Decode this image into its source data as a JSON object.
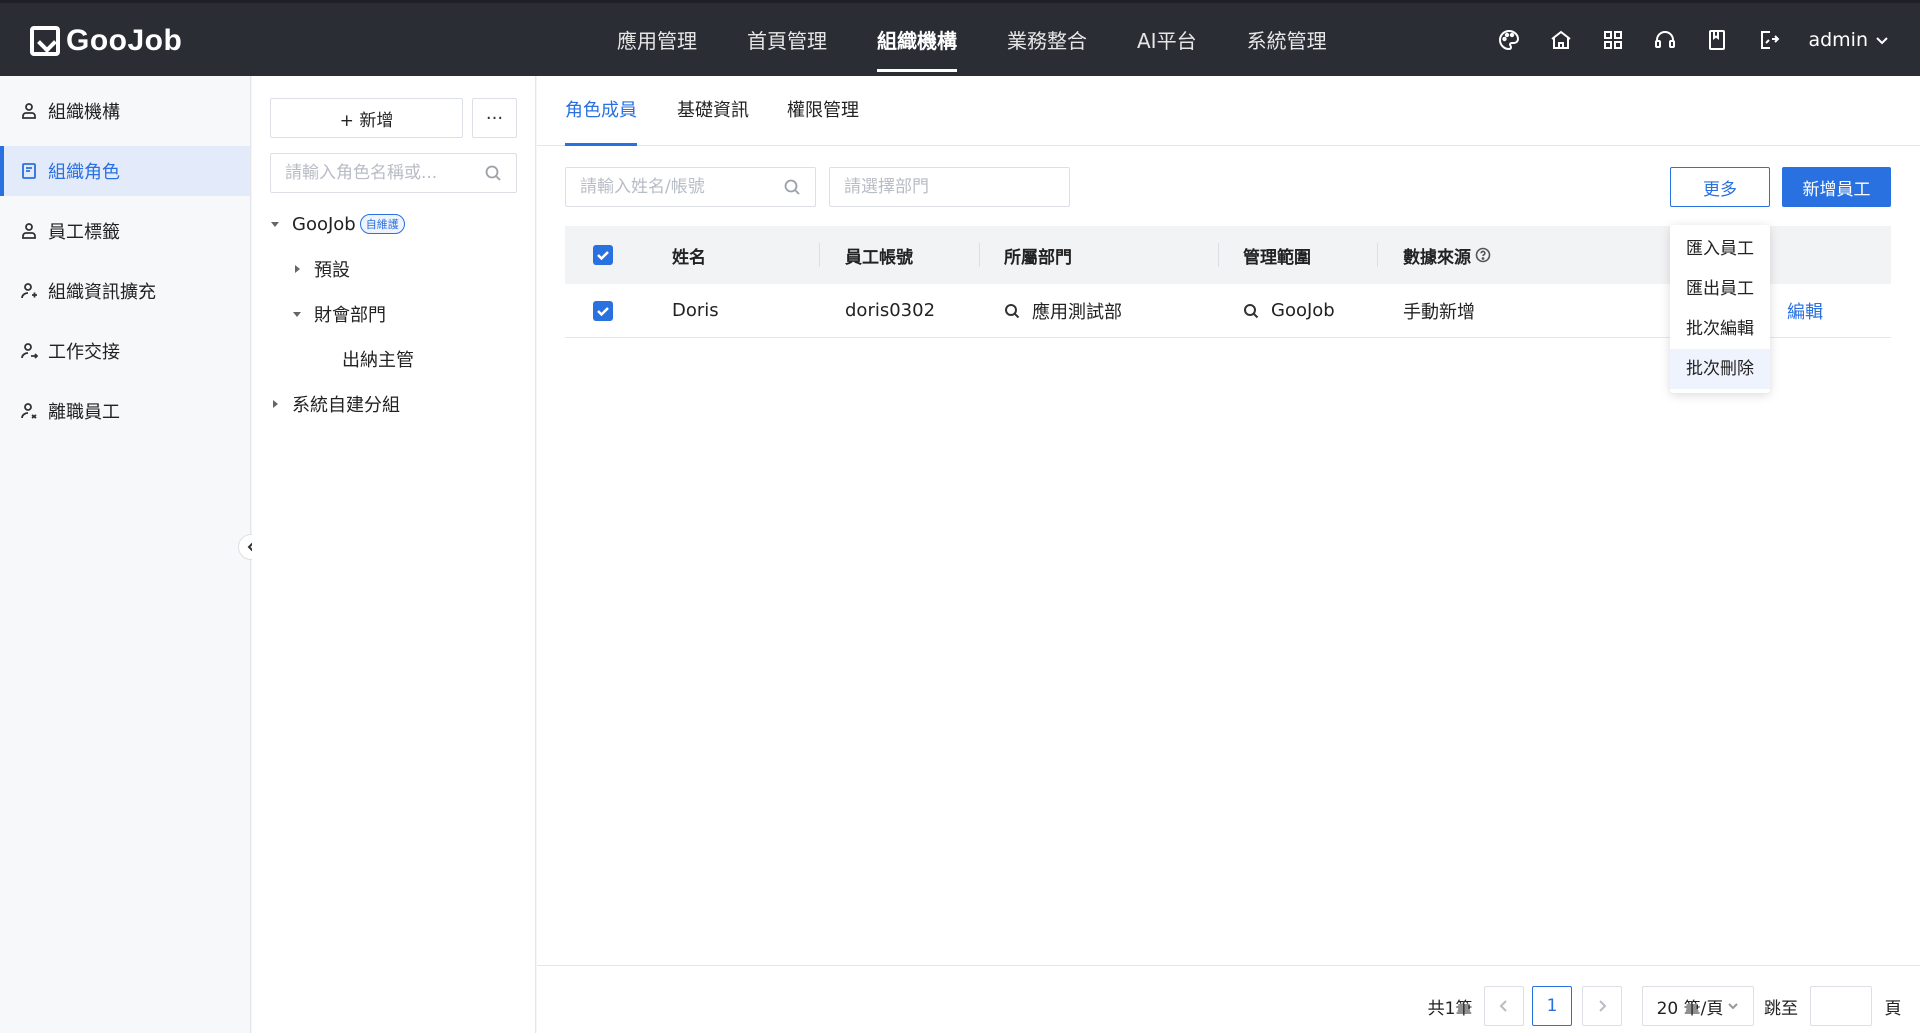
{
  "brand": {
    "name": "GooJob"
  },
  "topnav": {
    "items": [
      {
        "label": "應用管理"
      },
      {
        "label": "首頁管理"
      },
      {
        "label": "組織機構"
      },
      {
        "label": "業務整合"
      },
      {
        "label": "AI平台"
      },
      {
        "label": "系統管理"
      }
    ],
    "active": "組織機構",
    "icons": [
      "palette-icon",
      "home-icon",
      "apps-grid-icon",
      "support-icon",
      "book-icon",
      "export-icon"
    ],
    "user": "admin"
  },
  "sidebar": {
    "items": [
      {
        "label": "組織機構",
        "icon": "org-icon"
      },
      {
        "label": "組織角色",
        "icon": "role-icon",
        "active": true
      },
      {
        "label": "員工標籤",
        "icon": "tag-user-icon"
      },
      {
        "label": "組織資訊擴充",
        "icon": "user-extend-icon"
      },
      {
        "label": "工作交接",
        "icon": "handover-icon"
      },
      {
        "label": "離職員工",
        "icon": "resigned-icon"
      }
    ]
  },
  "tree": {
    "add_label": "+ 新增",
    "more_label": "···",
    "search_placeholder": "請輸入角色名稱或...",
    "nodes": [
      {
        "label": "GooJob",
        "badge": "自維護"
      },
      {
        "label": "預設"
      },
      {
        "label": "財會部門"
      },
      {
        "label": "出納主管"
      },
      {
        "label": "系統自建分組"
      }
    ]
  },
  "tabs": [
    {
      "label": "角色成員"
    },
    {
      "label": "基礎資訊"
    },
    {
      "label": "權限管理"
    }
  ],
  "filters": {
    "name_placeholder": "請輸入姓名/帳號",
    "dept_placeholder": "請選擇部門"
  },
  "actions": {
    "more_label": "更多",
    "add_employee_label": "新增員工"
  },
  "table": {
    "columns": [
      "姓名",
      "員工帳號",
      "所屬部門",
      "管理範圍",
      "數據來源"
    ],
    "rows": [
      {
        "name": "Doris",
        "account": "doris0302",
        "department": "應用測試部",
        "scope": "GooJob",
        "source": "手動新增",
        "action": "編輯"
      }
    ]
  },
  "dropdown": {
    "items": [
      "匯入員工",
      "匯出員工",
      "批次編輯",
      "批次刪除"
    ],
    "hovered": "批次刪除"
  },
  "pagination": {
    "total_label": "共1筆",
    "current_page": "1",
    "page_size_label": "20 筆/頁",
    "jump_label": "跳至",
    "page_suffix": "頁"
  },
  "colors": {
    "primary": "#2970e0",
    "topbar": "#2b2d35"
  }
}
